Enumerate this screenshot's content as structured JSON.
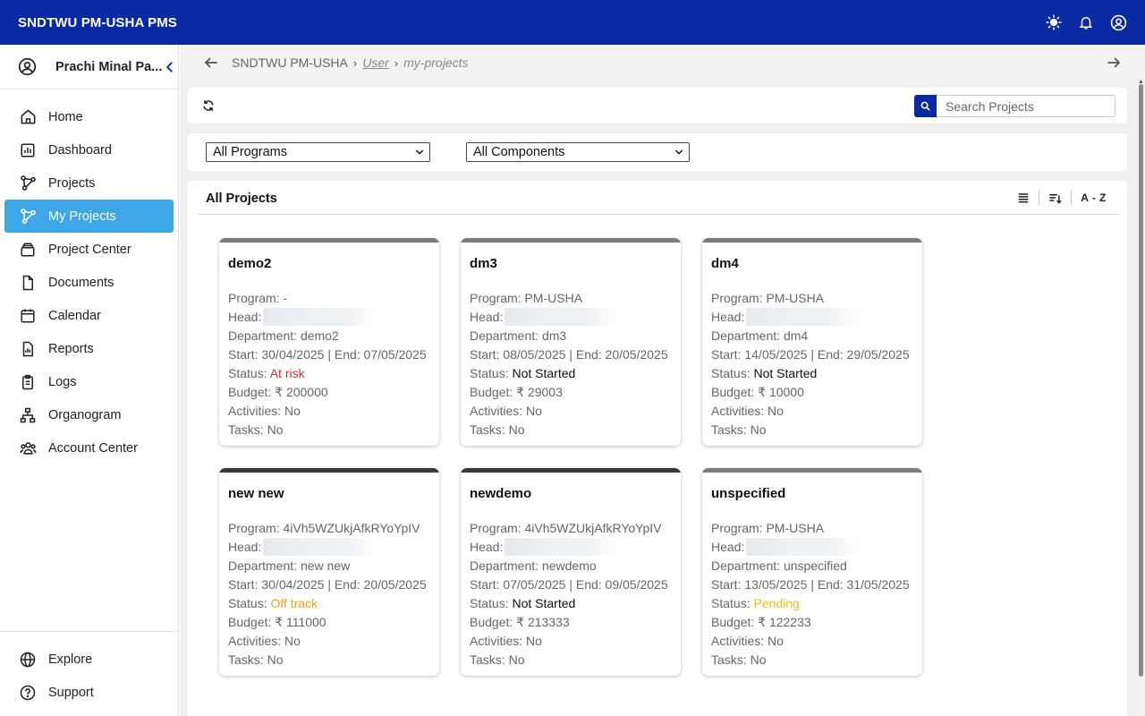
{
  "app": {
    "title": "SNDTWU PM-USHA PMS"
  },
  "topbar": {
    "icons": [
      "sun-icon",
      "bell-icon",
      "account-circle-icon"
    ]
  },
  "sidebar": {
    "user_name": "Prachi Minal Pa...",
    "items": [
      {
        "label": "Home",
        "icon": "home-icon"
      },
      {
        "label": "Dashboard",
        "icon": "chart-icon"
      },
      {
        "label": "Projects",
        "icon": "projects-icon"
      },
      {
        "label": "My Projects",
        "icon": "my-projects-icon",
        "active": true
      },
      {
        "label": "Project Center",
        "icon": "archive-box-icon"
      },
      {
        "label": "Documents",
        "icon": "document-icon"
      },
      {
        "label": "Calendar",
        "icon": "calendar-icon"
      },
      {
        "label": "Reports",
        "icon": "reports-icon"
      },
      {
        "label": "Logs",
        "icon": "clipboard-icon"
      },
      {
        "label": "Organogram",
        "icon": "org-chart-icon"
      },
      {
        "label": "Account Center",
        "icon": "users-icon"
      }
    ],
    "bottom_items": [
      {
        "label": "Explore",
        "icon": "globe-icon"
      },
      {
        "label": "Support",
        "icon": "help-circle-icon"
      }
    ]
  },
  "breadcrumb": {
    "root": "SNDTWU PM-USHA",
    "link": "User",
    "current": "my-projects"
  },
  "search": {
    "placeholder": "Search Projects",
    "value": ""
  },
  "filters": {
    "program": "All Programs",
    "component": "All Components"
  },
  "projects": {
    "title": "All Projects",
    "sort_label": "A - Z",
    "labels": {
      "program": "Program: ",
      "head": "Head:",
      "department": "Department: ",
      "dates": "Start: {start} | End: {end}",
      "status": "Status: ",
      "budget": "Budget: ₹ ",
      "activities": "Activities: ",
      "tasks": "Tasks: "
    },
    "cards": [
      {
        "name": "demo2",
        "program": "-",
        "department": "demo2",
        "start": "30/04/2025",
        "end": "07/05/2025",
        "status": "At risk",
        "budget": "200000",
        "activities": "No",
        "tasks": "No",
        "stripe": "#7c7c7c",
        "status_color": "#d32f2f"
      },
      {
        "name": "dm3",
        "program": "PM-USHA",
        "department": "dm3",
        "start": "08/05/2025",
        "end": "20/05/2025",
        "status": "Not Started",
        "budget": "29003",
        "activities": "No",
        "tasks": "No",
        "stripe": "#7c7c7c",
        "status_color": "#111111"
      },
      {
        "name": "dm4",
        "program": "PM-USHA",
        "department": "dm4",
        "start": "14/05/2025",
        "end": "29/05/2025",
        "status": "Not Started",
        "budget": "10000",
        "activities": "No",
        "tasks": "No",
        "stripe": "#7c7c7c",
        "status_color": "#111111"
      },
      {
        "name": "new new",
        "program": "4iVh5WZUkjAfkRYoYpIV",
        "department": "new new",
        "start": "30/04/2025",
        "end": "20/05/2025",
        "status": "Off track",
        "budget": "111000",
        "activities": "No",
        "tasks": "No",
        "stripe": "#3a3a3a",
        "status_color": "#f0a11a"
      },
      {
        "name": "newdemo",
        "program": "4iVh5WZUkjAfkRYoYpIV",
        "department": "newdemo",
        "start": "07/05/2025",
        "end": "09/05/2025",
        "status": "Not Started",
        "budget": "213333",
        "activities": "No",
        "tasks": "No",
        "stripe": "#3a3a3a",
        "status_color": "#111111"
      },
      {
        "name": "unspecified",
        "program": "PM-USHA",
        "department": "unspecified",
        "start": "13/05/2025",
        "end": "31/05/2025",
        "status": "Pending",
        "budget": "122233",
        "activities": "No",
        "tasks": "No",
        "stripe": "#7c7c7c",
        "status_color": "#e8c310"
      }
    ]
  },
  "colors": {
    "brand": "#0a2aa3",
    "active_nav": "#3fa6e8"
  }
}
